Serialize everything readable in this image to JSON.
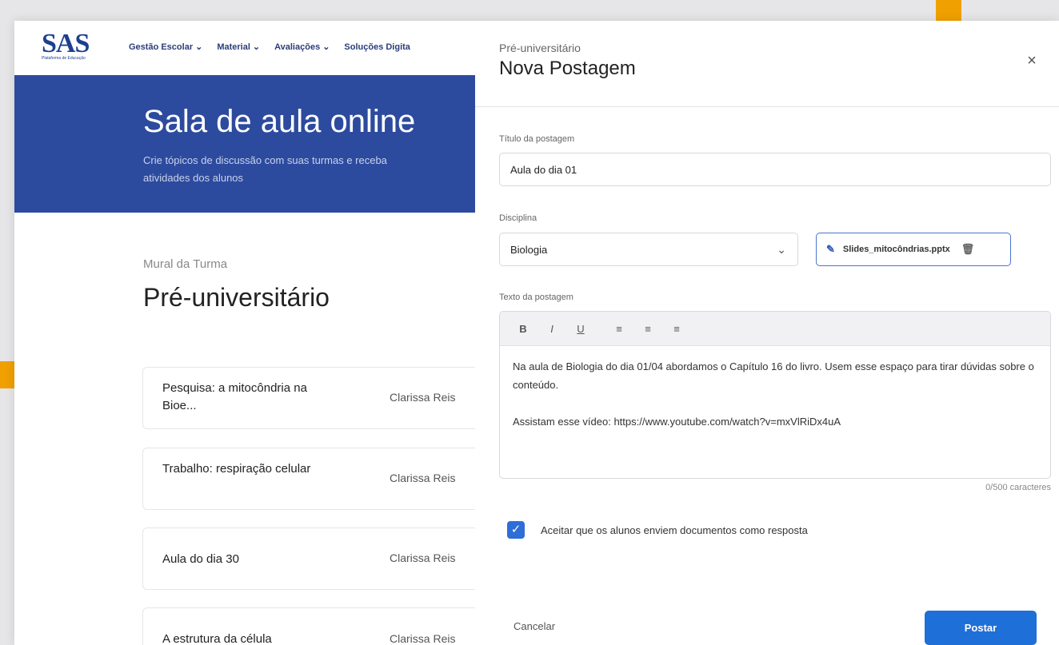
{
  "brand": {
    "logo": "SAS",
    "tagline": "Plataforma de Educação"
  },
  "nav": {
    "items": [
      {
        "label": "Gestão Escolar"
      },
      {
        "label": "Material"
      },
      {
        "label": "Avaliações"
      },
      {
        "label": "Soluções Digita"
      }
    ]
  },
  "hero": {
    "title": "Sala de aula online",
    "subtitle": "Crie tópicos de discussão com suas turmas e receba atividades dos alunos"
  },
  "mural": {
    "label": "Mural da Turma",
    "title": "Pré-universitário",
    "posts": [
      {
        "title": "Pesquisa: a mitocôndria na Bioe...",
        "author": "Clarissa Reis"
      },
      {
        "title": "Trabalho: respiração celular",
        "author": "Clarissa Reis"
      },
      {
        "title": "Aula do dia 30",
        "author": "Clarissa Reis"
      },
      {
        "title": "A estrutura da célula",
        "author": "Clarissa Reis"
      }
    ]
  },
  "modal": {
    "context": "Pré-universitário",
    "title": "Nova Postagem",
    "close_symbol": "×",
    "title_field": {
      "label": "Título da postagem",
      "value": "Aula do dia 01"
    },
    "discipline": {
      "label": "Disciplina",
      "value": "Biologia"
    },
    "attachment": {
      "filename": "Slides_mitocôndrias.pptx"
    },
    "body": {
      "label": "Texto da postagem",
      "toolbar": [
        "B",
        "I",
        "U",
        "≡",
        "≡",
        "≡"
      ],
      "text": "Na aula de Biologia do dia 01/04 abordamos o Capítulo 16 do livro. Usem esse espaço para tirar dúvidas sobre o conteúdo.\n\nAssistam esse vídeo: https://www.youtube.com/watch?v=mxVlRiDx4uA",
      "counter": "0/500 caracteres"
    },
    "accept_documents": {
      "label": "Aceitar que os alunos enviem documentos como resposta",
      "checked": true
    },
    "cancel_label": "Cancelar",
    "submit_label": "Postar"
  },
  "colors": {
    "primary": "#2d4b9e",
    "button": "#1f6fd8",
    "accent": "#f0a000"
  }
}
